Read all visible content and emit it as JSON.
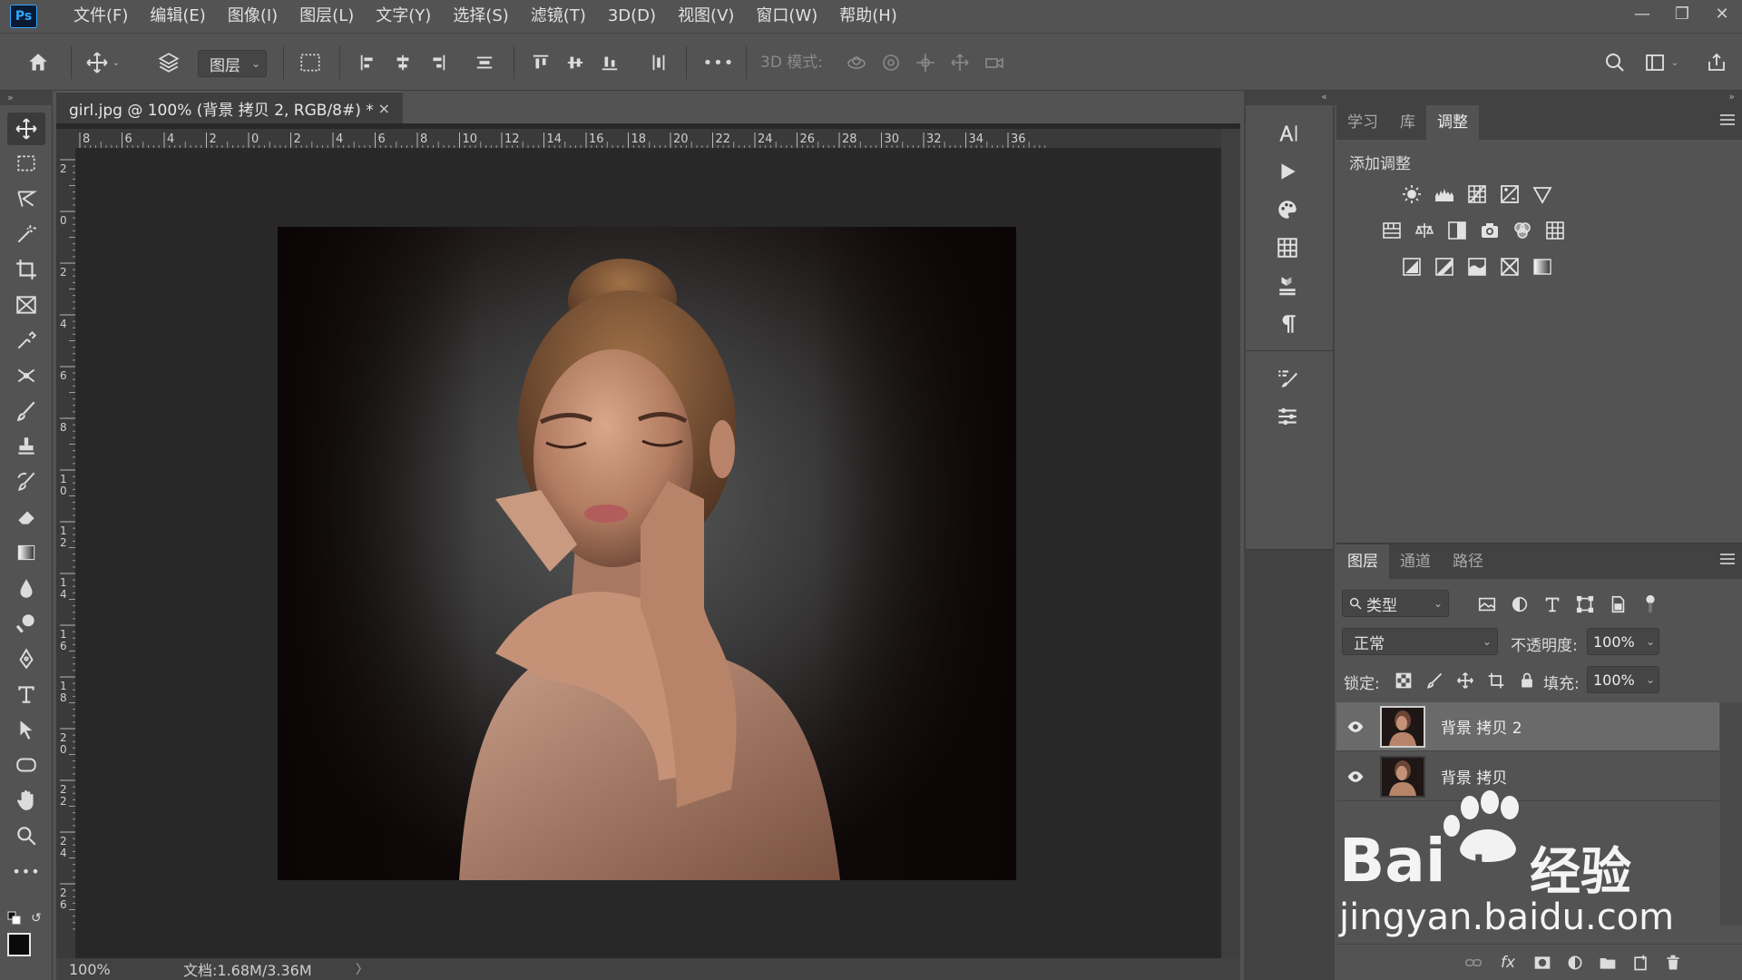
{
  "app": {
    "logo_text": "Ps",
    "menu": [
      "文件(F)",
      "编辑(E)",
      "图像(I)",
      "图层(L)",
      "文字(Y)",
      "选择(S)",
      "滤镜(T)",
      "3D(D)",
      "视图(V)",
      "窗口(W)",
      "帮助(H)"
    ],
    "window_controls": [
      "minimize-icon",
      "restore-icon",
      "close-icon"
    ]
  },
  "options_bar": {
    "layer_select_value": "图层",
    "mode_3d_label": "3D 模式:",
    "more_label": "•••"
  },
  "document": {
    "tab_title": "girl.jpg @ 100% (背景 拷贝 2, RGB/8#) *",
    "tab_close": "×",
    "zoom": "100%",
    "doc_size": "文档:1.68M/3.36M",
    "status_arrow": "〉",
    "h_ruler_ticks": [
      "8",
      "6",
      "4",
      "2",
      "0",
      "2",
      "4",
      "6",
      "8",
      "10",
      "12",
      "14",
      "16",
      "18",
      "20",
      "22",
      "24",
      "26",
      "28",
      "30",
      "32",
      "34",
      "36"
    ],
    "v_ruler_ticks": [
      "2",
      "0",
      "2",
      "4",
      "6",
      "8",
      "10",
      "12",
      "14",
      "16",
      "18",
      "20",
      "22",
      "24",
      "26"
    ]
  },
  "toolbar": {
    "tools": [
      "move-tool",
      "marquee-tool",
      "lasso-tool",
      "magic-wand-tool",
      "crop-tool",
      "frame-tool",
      "eyedropper-tool",
      "healing-tool",
      "brush-tool",
      "stamp-tool",
      "history-brush-tool",
      "eraser-tool",
      "gradient-tool",
      "blur-tool",
      "dodge-tool",
      "pen-tool",
      "type-tool",
      "path-select-tool",
      "shape-tool",
      "hand-tool",
      "zoom-tool",
      "more-tools"
    ],
    "more_label": "•••"
  },
  "adjustments_panel": {
    "tabs": [
      "学习",
      "库",
      "调整"
    ],
    "active_tab": "调整",
    "title": "添加调整"
  },
  "layers_panel": {
    "tabs": [
      "图层",
      "通道",
      "路径"
    ],
    "active_tab": "图层",
    "filter_value": "类型",
    "blend_mode": "正常",
    "opacity_label": "不透明度:",
    "opacity_value": "100%",
    "lock_label": "锁定:",
    "fill_label": "填充:",
    "fill_value": "100%",
    "layers": [
      {
        "name": "背景 拷贝 2",
        "selected": true,
        "visible": true
      },
      {
        "name": "背景 拷贝",
        "selected": false,
        "visible": true
      }
    ],
    "footer_fx": "fx"
  },
  "watermark": {
    "brand": "Bai",
    "brand_suffix": "经验",
    "url": "jingyan.baidu.com"
  },
  "colors": {
    "ui_bg": "#535353",
    "canvas_bg": "#282828",
    "accent": "#31a8ff"
  }
}
